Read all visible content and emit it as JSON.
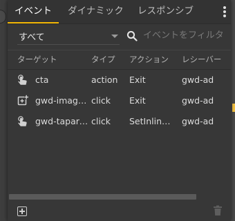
{
  "tabs": [
    {
      "label": "イベント",
      "active": true
    },
    {
      "label": "ダイナミック",
      "active": false
    },
    {
      "label": "レスポンシブ",
      "active": false
    }
  ],
  "filter": {
    "selected": "すべて",
    "search_placeholder": "イベントをフィルタ"
  },
  "table": {
    "headers": {
      "target": "ターゲット",
      "type": "タイプ",
      "action": "アクション",
      "receiver": "レシーバー"
    },
    "rows": [
      {
        "icon": "touch-icon",
        "target": "cta",
        "type": "action",
        "action": "Exit",
        "receiver": "gwd-ad"
      },
      {
        "icon": "image-add-icon",
        "target": "gwd-image...",
        "type": "click",
        "action": "Exit",
        "receiver": "gwd-ad"
      },
      {
        "icon": "touch-icon",
        "target": "gwd-taparea...",
        "type": "click",
        "action": "SetInlineStyle",
        "receiver": "gwd-ad"
      }
    ]
  },
  "colors": {
    "accent": "#f2b705",
    "panel": "#373737",
    "text": "#dcdcdc"
  }
}
